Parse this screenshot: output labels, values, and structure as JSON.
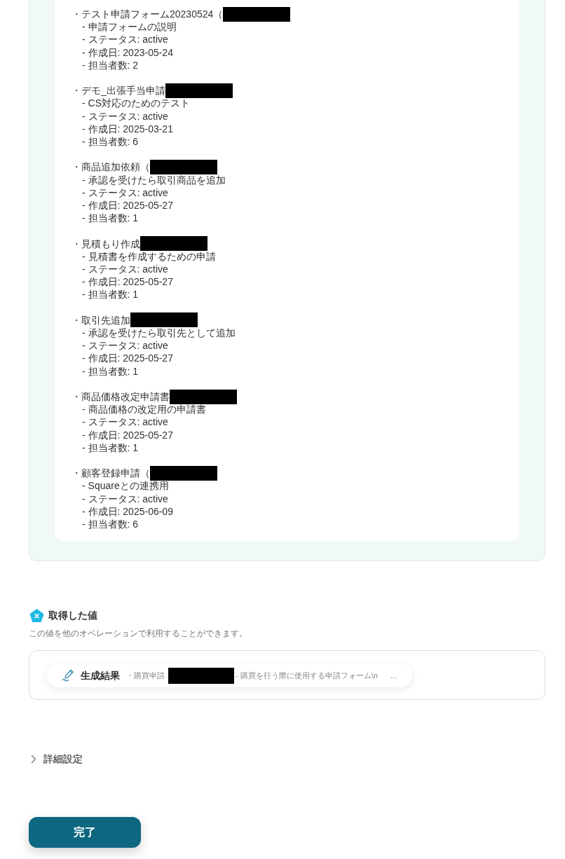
{
  "form_list": {
    "items": [
      {
        "title": "・テスト申請フォーム20230524（",
        "redacted": true,
        "details": [
          "- 申請フォームの説明",
          "- ステータス: active",
          "- 作成日: 2023-05-24",
          "- 担当者数: 2"
        ]
      },
      {
        "title": "・デモ_出張手当申請",
        "redacted": true,
        "details": [
          "- CS対応のためのテスト",
          "- ステータス: active",
          "- 作成日: 2025-03-21",
          "- 担当者数: 6"
        ]
      },
      {
        "title": "・商品追加依頼（",
        "redacted": true,
        "details": [
          "- 承認を受けたら取引商品を追加",
          "- ステータス: active",
          "- 作成日: 2025-05-27",
          "- 担当者数: 1"
        ]
      },
      {
        "title": "・見積もり作成",
        "redacted": true,
        "details": [
          "- 見積書を作成するための申請",
          "- ステータス: active",
          "- 作成日: 2025-05-27",
          "- 担当者数: 1"
        ]
      },
      {
        "title": "・取引先追加",
        "redacted": true,
        "details": [
          "- 承認を受けたら取引先として追加",
          "- ステータス: active",
          "- 作成日: 2025-05-27",
          "- 担当者数: 1"
        ]
      },
      {
        "title": "・商品価格改定申請書",
        "redacted": true,
        "details": [
          "- 商品価格の改定用の申請書",
          "- ステータス: active",
          "- 作成日: 2025-05-27",
          "- 担当者数: 1"
        ]
      },
      {
        "title": "・顧客登録申請（",
        "redacted": true,
        "details": [
          "- Squareとの連携用",
          "- ステータス: active",
          "- 作成日: 2025-06-09",
          "- 担当者数: 6"
        ]
      }
    ]
  },
  "acquired_values": {
    "title": "取得した値",
    "description": "この値を他のオペレーションで利用することができます。",
    "items": [
      {
        "label": "生成結果",
        "value_start": "・購買申請",
        "redacted": true,
        "value_end": "- 購買を行う際に使用する申請フォーム\\n",
        "ellipsis": "..."
      }
    ]
  },
  "advanced_settings": {
    "label": "詳細設定",
    "expanded": false
  },
  "complete_button": {
    "label": "完了"
  }
}
